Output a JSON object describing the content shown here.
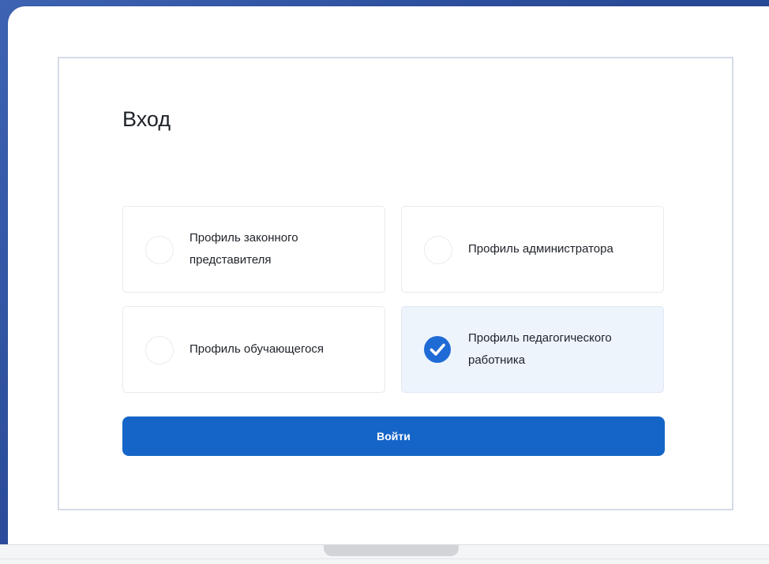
{
  "login": {
    "title": "Вход",
    "options": [
      {
        "label": "Профиль законного представителя",
        "selected": false
      },
      {
        "label": "Профиль администратора",
        "selected": false
      },
      {
        "label": "Профиль обучающегося",
        "selected": false
      },
      {
        "label": "Профиль педагогического работника",
        "selected": true
      }
    ],
    "submit_label": "Войти"
  },
  "colors": {
    "accent": "#1565c8",
    "selected_bg": "#eef4fc",
    "check": "#1f6bd6",
    "backdrop": "#2a4c9a"
  },
  "icons": {
    "unselected": "radio-empty-icon",
    "selected": "checkmark-circle-icon"
  }
}
